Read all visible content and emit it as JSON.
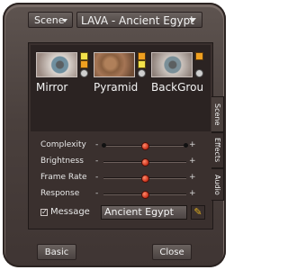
{
  "header": {
    "scene_menu_label": "Scene",
    "preset_value": "LAVA - Ancient Egypt"
  },
  "thumbnails": [
    {
      "label": "Mirror"
    },
    {
      "label": "Pyramid"
    },
    {
      "label": "BackGrou"
    }
  ],
  "sliders": [
    {
      "label": "Complexity",
      "minus": "-",
      "plus": "+",
      "level": 0.5
    },
    {
      "label": "Brightness",
      "minus": "-",
      "plus": "+",
      "level": 0.5
    },
    {
      "label": "Frame Rate",
      "minus": "-",
      "plus": "+",
      "level": 0.5
    },
    {
      "label": "Response",
      "minus": "-",
      "plus": "+",
      "level": 0.5
    }
  ],
  "message": {
    "label": "Message",
    "checked": true,
    "value": "Ancient Egypt"
  },
  "tabs": [
    "Scene",
    "Effects",
    "Audio"
  ],
  "footer": {
    "basic_label": "Basic",
    "close_label": "Close"
  }
}
